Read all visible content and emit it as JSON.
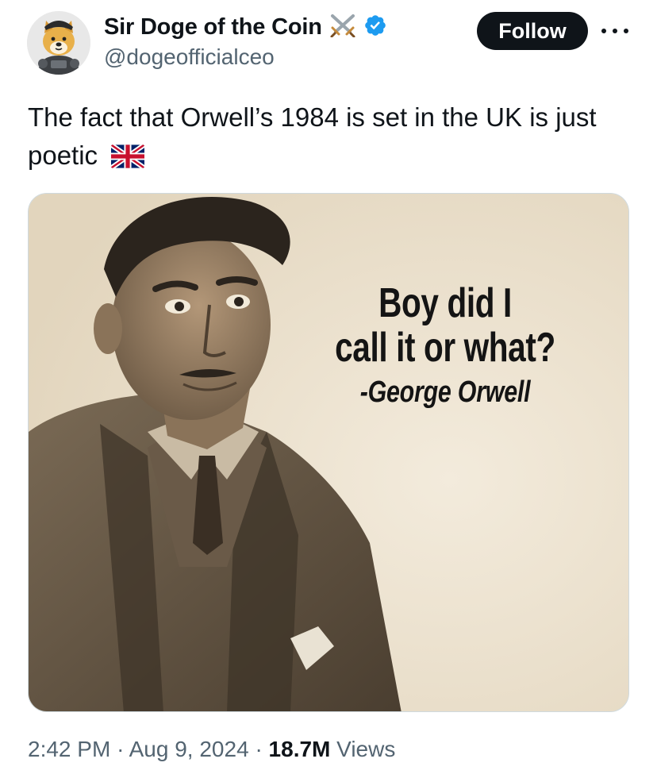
{
  "author": {
    "display_name": "Sir Doge of the Coin",
    "handle": "@dogeofficialceo",
    "name_emoji_icon": "crossed-swords-icon",
    "verified_icon": "verified-badge-icon",
    "verified_color": "#1d9bf0",
    "avatar_icon": "doge-knight-avatar"
  },
  "follow_label": "Follow",
  "more_icon": "more-options-icon",
  "tweet": {
    "text": "The fact that Orwell’s 1984 is set in the UK is just poetic",
    "emoji_icon": "uk-flag-icon"
  },
  "media": {
    "quote_line1": "Boy did I",
    "quote_line2": "call it or what?",
    "quote_author": "-George Orwell",
    "background_color": "#eee4d2"
  },
  "meta": {
    "time": "2:42 PM",
    "sep1": "·",
    "date": "Aug 9, 2024",
    "sep2": "·",
    "views_count": "18.7M",
    "views_label": "Views"
  },
  "colors": {
    "text_primary": "#0f1419",
    "text_secondary": "#536471",
    "follow_bg": "#0f1419"
  }
}
